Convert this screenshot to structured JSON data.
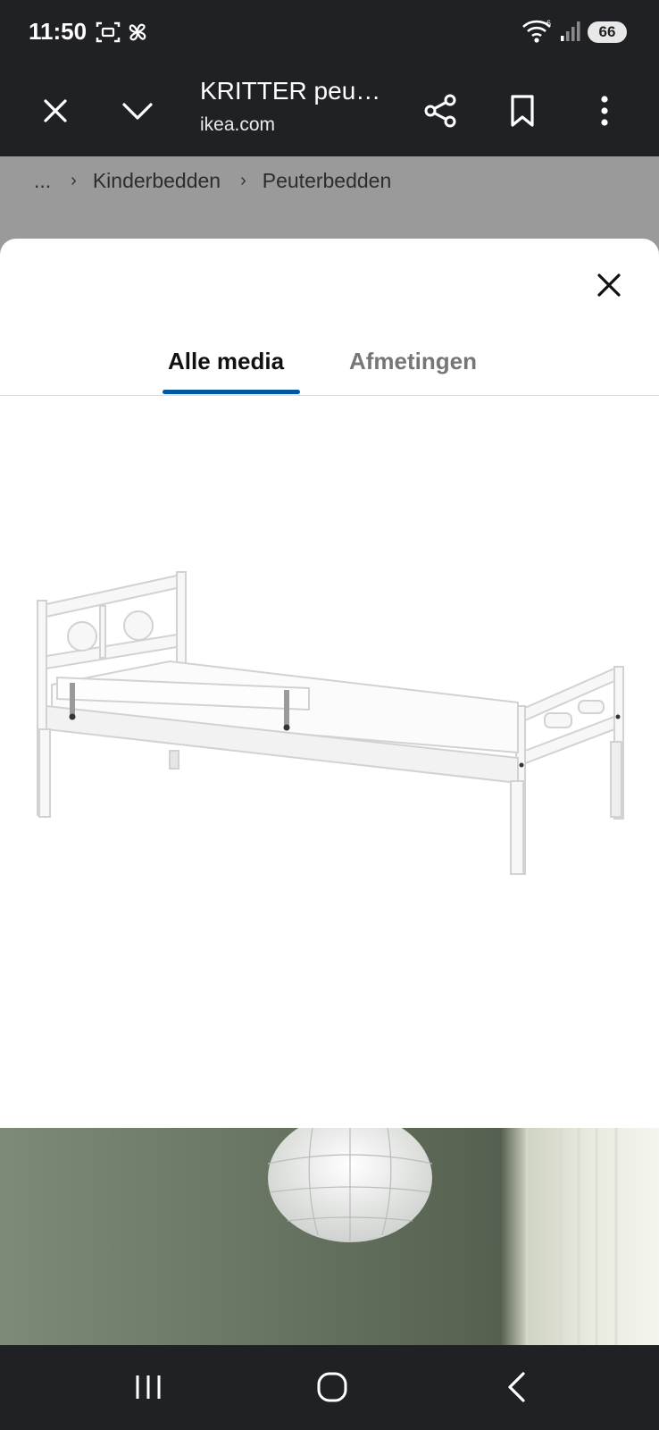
{
  "status_bar": {
    "time": "11:50",
    "battery": "66"
  },
  "browser": {
    "title": "KRITTER peu…",
    "url": "ikea.com",
    "icons": [
      "close-icon",
      "chevron-down-icon",
      "share-icon",
      "bookmark-icon",
      "more-vert-icon"
    ]
  },
  "breadcrumb": {
    "ellipsis": "...",
    "items": [
      "Kinderbedden",
      "Peuterbedden"
    ]
  },
  "media_sheet": {
    "tabs": [
      {
        "label": "Alle media",
        "active": true
      },
      {
        "label": "Afmetingen",
        "active": false
      }
    ]
  },
  "colors": {
    "header_bg": "#202124",
    "accent_underline": "#0058a3",
    "backdrop": "#9a9a9a"
  },
  "navigation_bar": {
    "icons": [
      "recent-apps-icon",
      "home-icon",
      "back-icon"
    ]
  }
}
